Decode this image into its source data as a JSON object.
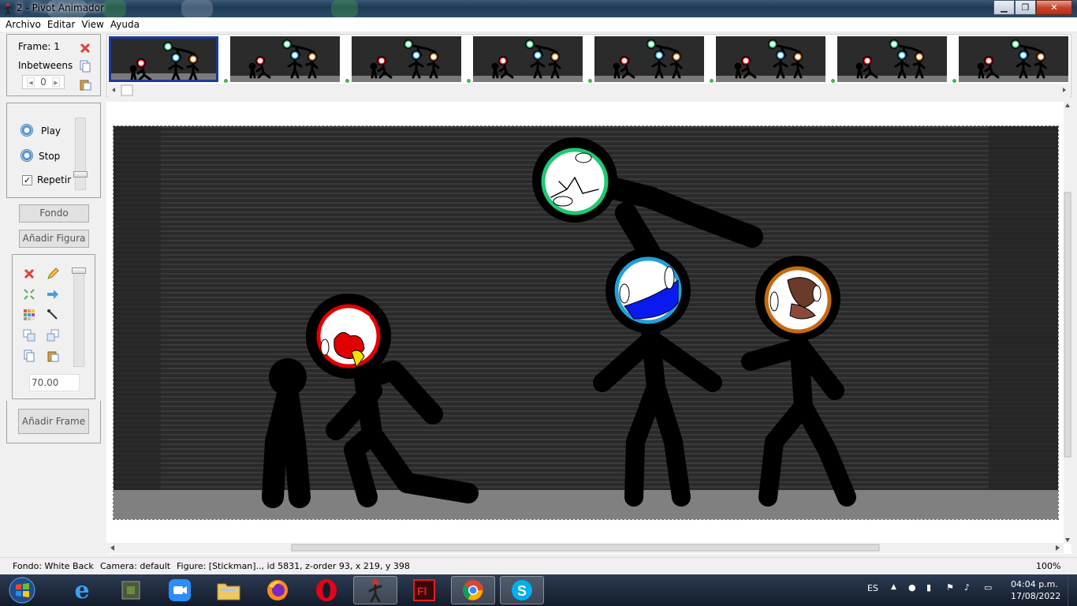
{
  "window": {
    "title": "2 - Pivot Animador"
  },
  "menu": {
    "items": [
      "Archivo",
      "Editar",
      "View",
      "Ayuda"
    ]
  },
  "frame_panel": {
    "frame_label": "Frame: 1",
    "inbetweens_label": "Inbetweens",
    "inbetweens_value": "0"
  },
  "playback": {
    "play_label": "Play",
    "stop_label": "Stop",
    "repeat_label": "Repetir",
    "repeat_checked": true
  },
  "buttons": {
    "background": "Fondo",
    "add_figure": "Añadir Figura",
    "add_frame": "Añadir Frame"
  },
  "tools": {
    "size_value": "70.00"
  },
  "thumbnails": {
    "count": 8,
    "selected_index": 0
  },
  "status": {
    "background": "Fondo: White Back",
    "camera": "Camera: default",
    "figure": "Figure: [Stickman]..,  id 5831,  z-order 93,  x 219, y 398",
    "zoom": "100%"
  },
  "taskbar": {
    "apps": [
      "start-orb",
      "internet-explorer",
      "minecraft",
      "zoom",
      "file-explorer",
      "firefox",
      "opera",
      "pivot-animator",
      "flash",
      "chrome",
      "skype"
    ],
    "active_app": "pivot-animator",
    "language": "ES",
    "time": "04:04 p.m.",
    "date": "17/08/2022"
  },
  "colors": {
    "selection": "#1a3a9c",
    "stage_bg": "#2b2b2b",
    "floor": "#808080"
  }
}
